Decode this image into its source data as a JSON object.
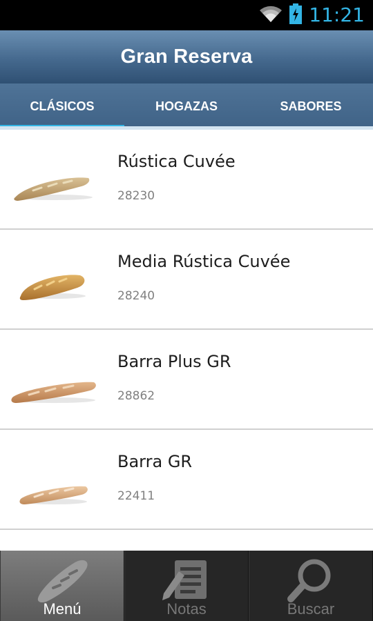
{
  "status_bar": {
    "time": "11:21",
    "icons": [
      "wifi-icon",
      "battery-charging-icon"
    ],
    "time_color": "#33b5e5"
  },
  "app_bar": {
    "title": "Gran Reserva"
  },
  "tabs": [
    {
      "label": "CLÁSICOS",
      "active": true
    },
    {
      "label": "HOGAZAS",
      "active": false
    },
    {
      "label": "SABORES",
      "active": false
    }
  ],
  "products": [
    {
      "name": "Rústica Cuvée",
      "code": "28230",
      "image": "bread-baguette-rustica"
    },
    {
      "name": "Media Rústica Cuvée",
      "code": "28240",
      "image": "bread-half-rustica"
    },
    {
      "name": "Barra Plus GR",
      "code": "28862",
      "image": "bread-barra-plus"
    },
    {
      "name": "Barra GR",
      "code": "22411",
      "image": "bread-barra"
    }
  ],
  "bottom_nav": [
    {
      "label": "Menú",
      "icon": "bread-icon",
      "active": true
    },
    {
      "label": "Notas",
      "icon": "notes-icon",
      "active": false
    },
    {
      "label": "Buscar",
      "icon": "search-icon",
      "active": false
    }
  ],
  "colors": {
    "accent": "#33b5e5",
    "app_bar": "#45698e",
    "tab_bar": "#4a6e92",
    "bottom_nav": "#262626"
  }
}
